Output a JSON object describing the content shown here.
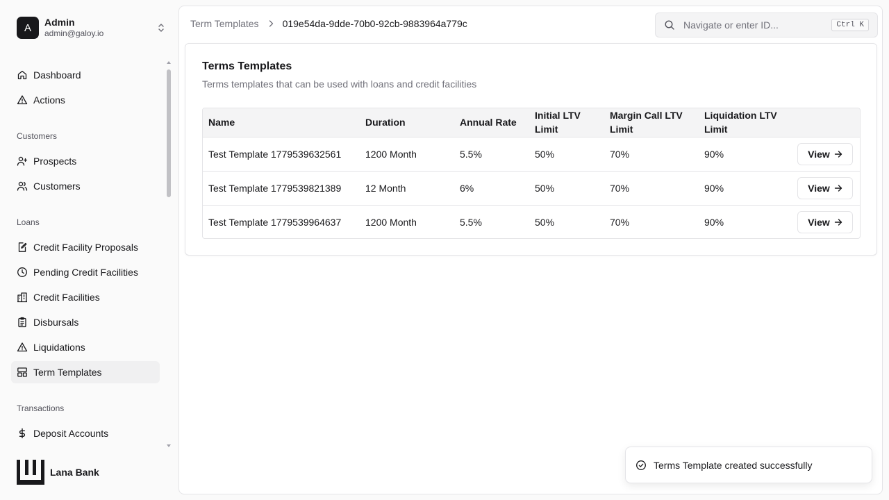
{
  "user": {
    "initial": "A",
    "name": "Admin",
    "email": "admin@galoy.io"
  },
  "nav": {
    "dashboard": "Dashboard",
    "actions": "Actions",
    "customers_group": "Customers",
    "prospects": "Prospects",
    "customers": "Customers",
    "loans_group": "Loans",
    "credit_facility_proposals": "Credit Facility Proposals",
    "pending_credit_facilities": "Pending Credit Facilities",
    "credit_facilities": "Credit Facilities",
    "disbursals": "Disbursals",
    "liquidations": "Liquidations",
    "term_templates": "Term Templates",
    "transactions_group": "Transactions",
    "deposit_accounts": "Deposit Accounts"
  },
  "brand": {
    "name": "Lana Bank"
  },
  "breadcrumb": {
    "parent": "Term Templates",
    "current": "019e54da-9dde-70b0-92cb-9883964a779c"
  },
  "search": {
    "placeholder": "Navigate or enter ID...",
    "shortcut": "Ctrl K"
  },
  "card": {
    "title": "Terms Templates",
    "description": "Terms templates that can be used with loans and credit facilities"
  },
  "table": {
    "headers": {
      "name": "Name",
      "duration": "Duration",
      "annual_rate": "Annual Rate",
      "initial_ltv": "Initial LTV Limit",
      "margin_call_ltv": "Margin Call LTV Limit",
      "liquidation_ltv": "Liquidation LTV Limit"
    },
    "view_label": "View",
    "rows": [
      {
        "name": "Test Template 1779539632561",
        "duration": "1200 Month",
        "annual_rate": "5.5%",
        "initial_ltv": "50%",
        "margin_call_ltv": "70%",
        "liquidation_ltv": "90%"
      },
      {
        "name": "Test Template 1779539821389",
        "duration": "12 Month",
        "annual_rate": "6%",
        "initial_ltv": "50%",
        "margin_call_ltv": "70%",
        "liquidation_ltv": "90%"
      },
      {
        "name": "Test Template 1779539964637",
        "duration": "1200 Month",
        "annual_rate": "5.5%",
        "initial_ltv": "50%",
        "margin_call_ltv": "70%",
        "liquidation_ltv": "90%"
      }
    ]
  },
  "toast": {
    "message": "Terms Template created successfully"
  }
}
